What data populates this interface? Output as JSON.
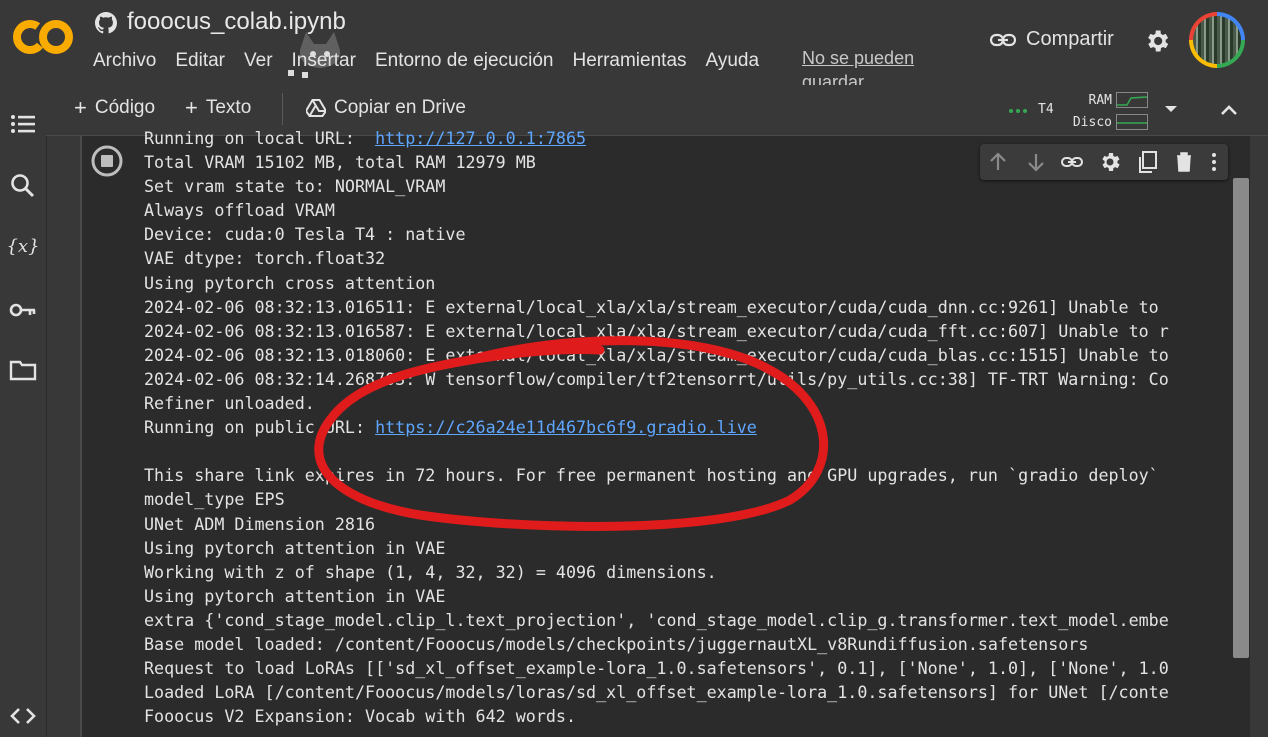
{
  "app": {
    "title": "fooocus_colab.ipynb",
    "logo_text": "CO",
    "brand_color": "#f9ab00"
  },
  "menu": {
    "items": [
      "Archivo",
      "Editar",
      "Ver",
      "Insertar",
      "Entorno de ejecución",
      "Herramientas",
      "Ayuda"
    ],
    "save_status": "No se pueden guardar"
  },
  "header": {
    "share_label": "Compartir"
  },
  "toolbar": {
    "code_label": "Código",
    "text_label": "Texto",
    "drive_label": "Copiar en Drive",
    "runtime_label": "T4",
    "ram_label": "RAM",
    "disk_label": "Disco"
  },
  "output": {
    "lines": [
      {
        "prefix": "Running on local URL:  ",
        "link": "http://127.0.0.1:7865",
        "suffix": ""
      },
      {
        "prefix": "Total VRAM 15102 MB, total RAM 12979 MB",
        "link": "",
        "suffix": ""
      },
      {
        "prefix": "Set vram state to: NORMAL_VRAM",
        "link": "",
        "suffix": ""
      },
      {
        "prefix": "Always offload VRAM",
        "link": "",
        "suffix": ""
      },
      {
        "prefix": "Device: cuda:0 Tesla T4 : native",
        "link": "",
        "suffix": ""
      },
      {
        "prefix": "VAE dtype: torch.float32",
        "link": "",
        "suffix": ""
      },
      {
        "prefix": "Using pytorch cross attention",
        "link": "",
        "suffix": ""
      },
      {
        "prefix": "2024-02-06 08:32:13.016511: E external/local_xla/xla/stream_executor/cuda/cuda_dnn.cc:9261] Unable to ",
        "link": "",
        "suffix": ""
      },
      {
        "prefix": "2024-02-06 08:32:13.016587: E external/local_xla/xla/stream_executor/cuda/cuda_fft.cc:607] Unable to r",
        "link": "",
        "suffix": ""
      },
      {
        "prefix": "2024-02-06 08:32:13.018060: E external/local_xla/xla/stream_executor/cuda/cuda_blas.cc:1515] Unable to",
        "link": "",
        "suffix": ""
      },
      {
        "prefix": "2024-02-06 08:32:14.268703: W tensorflow/compiler/tf2tensorrt/utils/py_utils.cc:38] TF-TRT Warning: Co",
        "link": "",
        "suffix": ""
      },
      {
        "prefix": "Refiner unloaded.",
        "link": "",
        "suffix": ""
      },
      {
        "prefix": "Running on public URL: ",
        "link": "https://c26a24e11d467bc6f9.gradio.live",
        "suffix": ""
      },
      {
        "prefix": "",
        "link": "",
        "suffix": ""
      },
      {
        "prefix": "This share link expires in 72 hours. For free permanent hosting and GPU upgrades, run `gradio deploy`",
        "link": "",
        "suffix": ""
      },
      {
        "prefix": "model_type EPS",
        "link": "",
        "suffix": ""
      },
      {
        "prefix": "UNet ADM Dimension 2816",
        "link": "",
        "suffix": ""
      },
      {
        "prefix": "Using pytorch attention in VAE",
        "link": "",
        "suffix": ""
      },
      {
        "prefix": "Working with z of shape (1, 4, 32, 32) = 4096 dimensions.",
        "link": "",
        "suffix": ""
      },
      {
        "prefix": "Using pytorch attention in VAE",
        "link": "",
        "suffix": ""
      },
      {
        "prefix": "extra {'cond_stage_model.clip_l.text_projection', 'cond_stage_model.clip_g.transformer.text_model.embe",
        "link": "",
        "suffix": ""
      },
      {
        "prefix": "Base model loaded: /content/Fooocus/models/checkpoints/juggernautXL_v8Rundiffusion.safetensors",
        "link": "",
        "suffix": ""
      },
      {
        "prefix": "Request to load LoRAs [['sd_xl_offset_example-lora_1.0.safetensors', 0.1], ['None', 1.0], ['None', 1.0",
        "link": "",
        "suffix": ""
      },
      {
        "prefix": "Loaded LoRA [/content/Fooocus/models/loras/sd_xl_offset_example-lora_1.0.safetensors] for UNet [/conte",
        "link": "",
        "suffix": ""
      },
      {
        "prefix": "Fooocus V2 Expansion: Vocab with 642 words.",
        "link": "",
        "suffix": ""
      }
    ]
  },
  "annotation": {
    "color": "#e01b1b"
  }
}
